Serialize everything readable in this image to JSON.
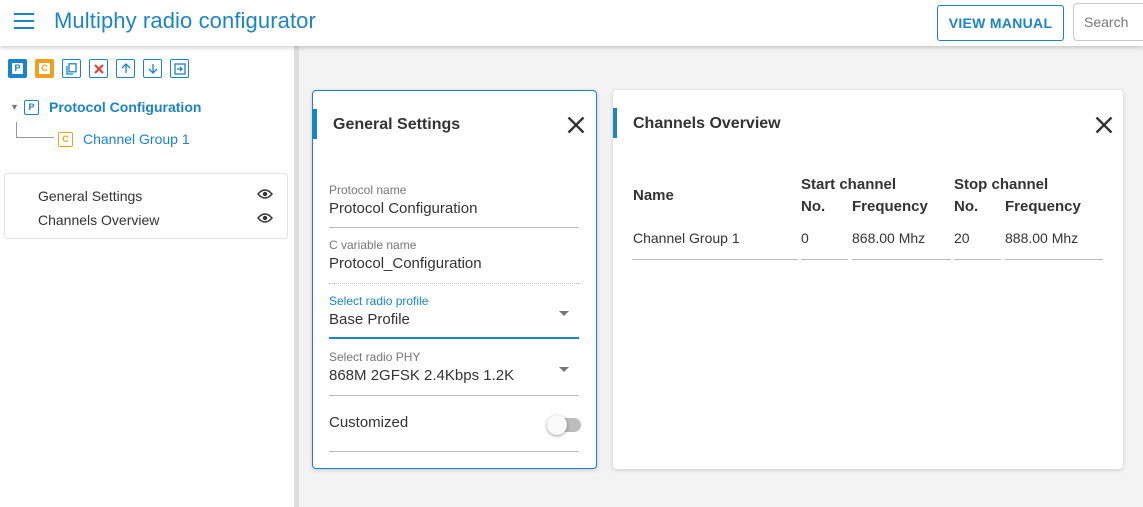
{
  "header": {
    "title": "Multiphy radio configurator",
    "view_manual": "VIEW MANUAL",
    "search_placeholder": "Search"
  },
  "sidebar": {
    "toolbar": [
      {
        "name": "add-protocol-button",
        "glyph": "P"
      },
      {
        "name": "add-channel-button",
        "glyph": "C"
      },
      {
        "name": "copy-button",
        "glyph": "copy-icon"
      },
      {
        "name": "delete-button",
        "glyph": "close-icon"
      },
      {
        "name": "move-up-button",
        "glyph": "arrow-up-icon"
      },
      {
        "name": "move-down-button",
        "glyph": "arrow-down-icon"
      },
      {
        "name": "import-button",
        "glyph": "import-icon"
      }
    ],
    "tree": {
      "protocol": {
        "badge": "P",
        "label": "Protocol Configuration"
      },
      "channel": {
        "badge": "C",
        "label": "Channel Group 1"
      }
    },
    "views": [
      {
        "label": "General Settings"
      },
      {
        "label": "Channels Overview"
      }
    ]
  },
  "general_settings": {
    "title": "General Settings",
    "fields": {
      "protocol_name": {
        "label": "Protocol name",
        "value": "Protocol Configuration"
      },
      "c_variable": {
        "label": "C variable name",
        "value": "Protocol_Configuration"
      },
      "radio_profile": {
        "label": "Select radio profile",
        "value": "Base Profile"
      },
      "radio_phy": {
        "label": "Select radio PHY",
        "value": "868M 2GFSK 2.4Kbps 1.2K"
      },
      "customized": {
        "label": "Customized",
        "value": false
      }
    }
  },
  "channels_overview": {
    "title": "Channels Overview",
    "headers": {
      "name": "Name",
      "start_channel": "Start channel",
      "stop_channel": "Stop channel",
      "no": "No.",
      "frequency": "Frequency"
    },
    "rows": [
      {
        "name": "Channel Group 1",
        "start_no": "0",
        "start_freq": "868.00 Mhz",
        "stop_no": "20",
        "stop_freq": "888.00 Mhz"
      }
    ]
  },
  "colors": {
    "accent": "#1a84c7",
    "channel_badge": "#f0a020",
    "delete": "#e53935"
  }
}
